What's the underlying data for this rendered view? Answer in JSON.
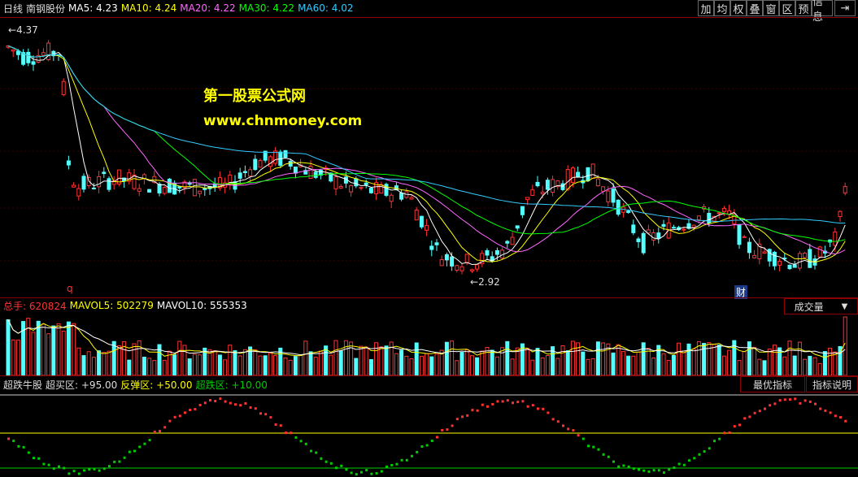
{
  "header": {
    "period": "日线",
    "stock_name": "南钢股份",
    "ma": [
      {
        "label": "MA5: 4.23",
        "color": "#ffffff"
      },
      {
        "label": "MA10: 4.24",
        "color": "#ffff00"
      },
      {
        "label": "MA20: 4.22",
        "color": "#ff66ff"
      },
      {
        "label": "MA30: 4.22",
        "color": "#00ff00"
      },
      {
        "label": "MA60: 4.02",
        "color": "#33ccff"
      }
    ],
    "buttons": [
      "加",
      "均",
      "权",
      "叠",
      "窗",
      "区",
      "预",
      "信息",
      "⇥"
    ]
  },
  "price_chart": {
    "high_label": "4.37",
    "low_label": "2.92",
    "marker_q": "q",
    "marker_cai": "财",
    "watermark_line1": "第一股票公式网",
    "watermark_line2": "www.chnmoney.com"
  },
  "volume": {
    "total_label": "总手: 620824",
    "mavol5_label": "MAVOL5: 502279",
    "mavol10_label": "MAVOL10: 555353",
    "selector": "成交量"
  },
  "indicator": {
    "name": "超跌牛股",
    "buy_label": "超买区: +95.00",
    "rebound_label": "反弹区: +50.00",
    "oversold_label": "超跌区: +10.00",
    "best_button": "最优指标",
    "help_button": "指标说明"
  },
  "colors": {
    "up": "#ff3232",
    "down": "#54ffff",
    "ma5": "#ffffff",
    "ma10": "#ffff00",
    "ma20": "#ff66ff",
    "ma30": "#00ff00",
    "ma60": "#33ccff"
  }
}
